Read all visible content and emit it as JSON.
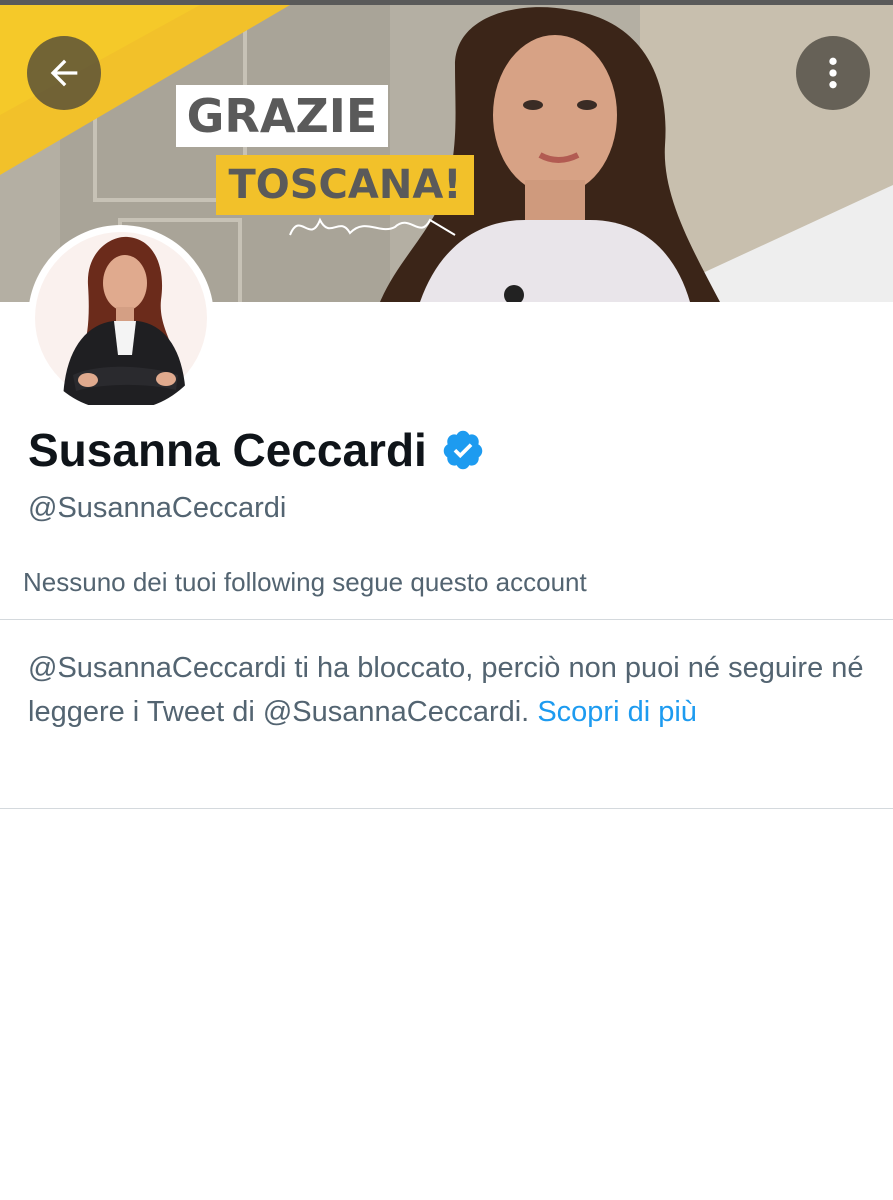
{
  "banner": {
    "headline_line1": "GRAZIE",
    "headline_line2": "TOSCANA!",
    "colors": {
      "accent_yellow": "#f2c12a",
      "headline_gray": "#5a5a5a"
    }
  },
  "header": {
    "back_icon": "arrow-left-icon",
    "more_icon": "vertical-dots-icon"
  },
  "profile": {
    "name": "Susanna Ceccardi",
    "verified_icon": "verified-badge-icon",
    "handle": "@SusannaCeccardi",
    "followers_you_know": "Nessuno dei tuoi following segue questo account"
  },
  "blocked_notice": {
    "text": "@SusannaCeccardi ti ha bloccato, perciò non puoi né seguire né leggere i Tweet di @SusannaCeccardi.",
    "link_label": "Scopri di più",
    "link_color": "#1d9bf0"
  }
}
